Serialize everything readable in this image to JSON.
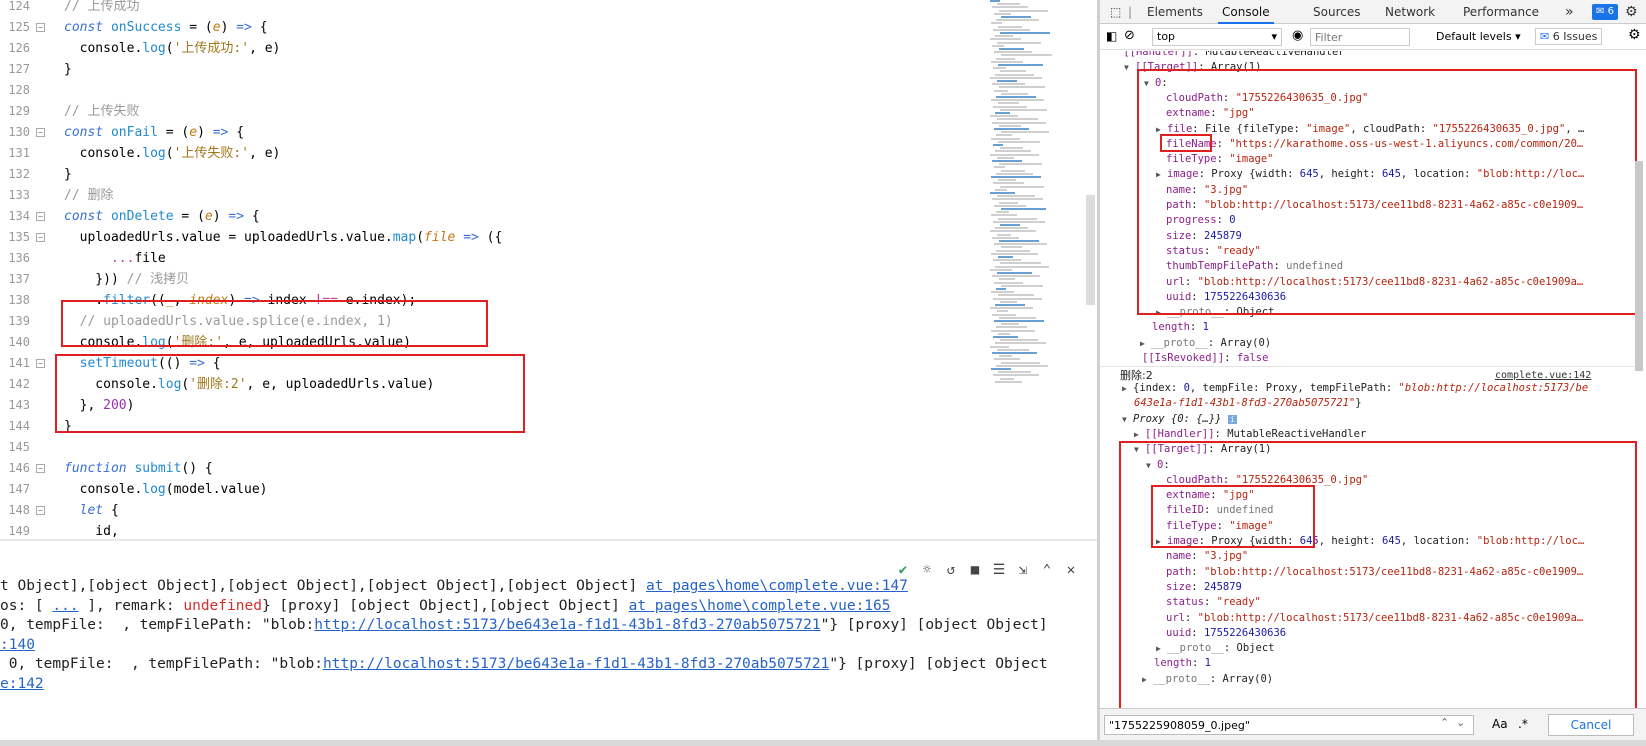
{
  "editor": {
    "lines": [
      {
        "n": "124",
        "fold": false,
        "html": "<span class=\"cm\">// 上传成功</span>"
      },
      {
        "n": "125",
        "fold": true,
        "html": "<span class=\"kw\">const</span> <span class=\"fn\">onSuccess</span> = (<span class=\"pa\">e</span>) <span class=\"kw\">=&gt;</span> {"
      },
      {
        "n": "126",
        "fold": false,
        "html": "  console.<span class=\"fn\">log</span>(<span class=\"st\">'上传成功:'</span>, e)"
      },
      {
        "n": "127",
        "fold": false,
        "html": "}"
      },
      {
        "n": "128",
        "fold": false,
        "html": ""
      },
      {
        "n": "129",
        "fold": false,
        "html": "<span class=\"cm\">// 上传失败</span>"
      },
      {
        "n": "130",
        "fold": true,
        "html": "<span class=\"kw\">const</span> <span class=\"fn\">onFail</span> = (<span class=\"pa\">e</span>) <span class=\"kw\">=&gt;</span> {"
      },
      {
        "n": "131",
        "fold": false,
        "html": "  console.<span class=\"fn\">log</span>(<span class=\"st\">'上传失败:'</span>, e)"
      },
      {
        "n": "132",
        "fold": false,
        "html": "}"
      },
      {
        "n": "133",
        "fold": false,
        "html": "<span class=\"cm\">// 删除</span>"
      },
      {
        "n": "134",
        "fold": true,
        "html": "<span class=\"kw\">const</span> <span class=\"fn\">onDelete</span> = (<span class=\"pa\">e</span>) <span class=\"kw\">=&gt;</span> {"
      },
      {
        "n": "135",
        "fold": true,
        "html": "  uploadedUrls.value = uploadedUrls.value.<span class=\"fn\">map</span>(<span class=\"pa\">file</span> <span class=\"kw\">=&gt;</span> ({"
      },
      {
        "n": "136",
        "fold": false,
        "html": "      <span class=\"sp\">...</span>file"
      },
      {
        "n": "137",
        "fold": false,
        "html": "    })) <span class=\"cm\">// 浅拷贝</span>"
      },
      {
        "n": "138",
        "fold": false,
        "html": "    .<span class=\"fn\">filter</span>((<span class=\"pa\">_</span>, <span class=\"pa\">index</span>) <span class=\"kw\">=&gt;</span> index <span class=\"sp\">!==</span> e.index);"
      },
      {
        "n": "139",
        "fold": false,
        "html": "  <span class=\"cm\">// uploadedUrls.value.splice(e.index, 1)</span>"
      },
      {
        "n": "140",
        "fold": false,
        "html": "  console.<span class=\"fn\">log</span>(<span class=\"st\">'删除:'</span>, e, uploadedUrls.value)"
      },
      {
        "n": "141",
        "fold": true,
        "html": "  <span class=\"fn\">setTimeout</span>(() <span class=\"kw\">=&gt;</span> {"
      },
      {
        "n": "142",
        "fold": false,
        "html": "    console.<span class=\"fn\">log</span>(<span class=\"st\">'删除:2'</span>, e, uploadedUrls.value)"
      },
      {
        "n": "143",
        "fold": false,
        "html": "  }, <span class=\"nu\">200</span>)"
      },
      {
        "n": "144",
        "fold": false,
        "html": "}"
      },
      {
        "n": "145",
        "fold": false,
        "html": ""
      },
      {
        "n": "146",
        "fold": true,
        "html": "<span class=\"kw\">function</span> <span class=\"fn\">submit</span>() {"
      },
      {
        "n": "147",
        "fold": false,
        "html": "  console.<span class=\"fn\">log</span>(model.value)"
      },
      {
        "n": "148",
        "fold": true,
        "html": "  <span class=\"kw\">let</span> {"
      },
      {
        "n": "149",
        "fold": false,
        "html": "    id,"
      }
    ]
  },
  "terminal": {
    "tools": [
      "✔",
      "☼",
      "↺",
      "■",
      "☰",
      "⇲",
      "⌃",
      "✕"
    ],
    "lines": [
      {
        "html": "t Object],[object Object],[object Object],[object Object],[object Object] <span class=\"lk\">at pages\\home\\complete.vue:147</span>"
      },
      {
        "html": "os: [ <span class=\"lk\">...</span> ], remark: <span class=\"cred\">undefined</span>} [proxy] [object Object],[object Object] <span class=\"lk\">at pages\\home\\complete.vue:165</span>"
      },
      {
        "html": "0, tempFile:  , tempFilePath: \"blob:<span class=\"lk\">http://localhost:5173/be643e1a-f1d1-43b1-8fd3-270ab5075721</span>\"} [proxy] [object Object]"
      },
      {
        "html": "<span class=\"lk\">:140</span>"
      },
      {
        "html": " 0, tempFile:  , tempFilePath: \"blob:<span class=\"lk\">http://localhost:5173/be643e1a-f1d1-43b1-8fd3-270ab5075721</span>\"} [proxy] [object Object"
      },
      {
        "html": "<span class=\"lk\">e:142</span>"
      }
    ]
  },
  "devtools": {
    "tabs": [
      "Elements",
      "Console",
      "Sources",
      "Network",
      "Performance"
    ],
    "more": "»",
    "badge": "6",
    "context": "top",
    "filter_placeholder": "Filter",
    "levels": "Default levels ▾",
    "issues": "6 Issues",
    "log_label": "删除:2",
    "log_link": "complete.vue:142",
    "console_lines": [
      {
        "x": 6,
        "html": "<span class=\"tri\"></span> <span class=\"k\">[[Handler]]</span>: MutableReactiveHandler"
      },
      {
        "x": 24,
        "html": "<span class=\"tri\">▼</span><span class=\"k\">[[Target]]</span>: Array(1)"
      },
      {
        "x": 44,
        "html": "<span class=\"tri\">▼</span><span class=\"k\">0</span>:"
      },
      {
        "x": 66,
        "html": "<span class=\"k\">cloudPath</span>: <span class=\"s\">\"1755226430635_0.jpg\"</span>"
      },
      {
        "x": 66,
        "html": "<span class=\"k\">extname</span>: <span class=\"s\">\"jpg\"</span>"
      },
      {
        "x": 56,
        "html": "<span class=\"tri\">▶</span><span class=\"k\">file</span>: File {fileType: <span class=\"s\">\"image\"</span>, cloudPath: <span class=\"s\">\"1755226430635_0.jpg\"</span>, …"
      },
      {
        "x": 66,
        "html": "<span class=\"k\">fileName</span>: <span class=\"s\">\"https://karathome.oss-us-west-1.aliyuncs.com/common/20…</span>"
      },
      {
        "x": 66,
        "html": "<span class=\"k\">fileType</span>: <span class=\"s\">\"image\"</span>"
      },
      {
        "x": 56,
        "html": "<span class=\"tri\">▶</span><span class=\"k\">image</span>: Proxy {width: <span class=\"n\">645</span>, height: <span class=\"n\">645</span>, location: <span class=\"s\">\"blob:http://loc…</span>"
      },
      {
        "x": 66,
        "html": "<span class=\"k\">name</span>: <span class=\"s\">\"3.jpg\"</span>"
      },
      {
        "x": 66,
        "html": "<span class=\"k\">path</span>: <span class=\"s\">\"blob:http://localhost:5173/cee11bd8-8231-4a62-a85c-c0e1909…</span>"
      },
      {
        "x": 66,
        "html": "<span class=\"k\">progress</span>: <span class=\"n\">0</span>"
      },
      {
        "x": 66,
        "html": "<span class=\"k\">size</span>: <span class=\"n\">245879</span>"
      },
      {
        "x": 66,
        "html": "<span class=\"k\">status</span>: <span class=\"s\">\"ready\"</span>"
      },
      {
        "x": 66,
        "html": "<span class=\"k\">thumbTempFilePath</span>: <span class=\"g\">undefined</span>"
      },
      {
        "x": 66,
        "html": "<span class=\"k\">url</span>: <span class=\"s\">\"blob:http://localhost:5173/cee11bd8-8231-4a62-a85c-c0e1909a…</span>"
      },
      {
        "x": 66,
        "html": "<span class=\"k\">uuid</span>: <span class=\"n\">1755226430636</span>"
      },
      {
        "x": 56,
        "html": "<span class=\"tri\">▶</span><span class=\"g\">__proto__</span>: Object"
      },
      {
        "x": 52,
        "html": "<span class=\"k\">length</span>: <span class=\"n\">1</span>"
      },
      {
        "x": 40,
        "html": "<span class=\"tri\">▶</span><span class=\"g\">__proto__</span>: Array(0)"
      },
      {
        "x": 42,
        "html": "<span class=\"k\">[[IsRevoked]]</span>: <span class=\"k\">false</span>"
      }
    ],
    "console_lines2": [
      {
        "x": 22,
        "html": "<span class=\"tri\">▶</span>{index: <span class=\"n\">0</span>, tempFile: Proxy, tempFilePath: <span class=\"s\"><i>\"blob:http://localhost:5173/be</i></span>"
      },
      {
        "x": 34,
        "html": "<span class=\"s\"><i>643e1a-f1d1-43b1-8fd3-270ab5075721\"</i></span>}"
      },
      {
        "x": 22,
        "html": "<span class=\"tri\">▼</span><i>Proxy {0: {…}}</i> <span style=\"color:#fff;background:#7aa7e0;font-size:8px;padding:0 2px\">i</span>"
      },
      {
        "x": 34,
        "html": "<span class=\"tri\">▶</span><span class=\"k\">[[Handler]]</span>: MutableReactiveHandler"
      },
      {
        "x": 34,
        "html": "<span class=\"tri\">▼</span><span class=\"k\">[[Target]]</span>: Array(1)"
      },
      {
        "x": 46,
        "html": "<span class=\"tri\">▼</span><span class=\"k\">0</span>:"
      },
      {
        "x": 66,
        "html": "<span class=\"k\">cloudPath</span>: <span class=\"s\">\"1755226430635_0.jpg\"</span>"
      },
      {
        "x": 66,
        "html": "<span class=\"k\">extname</span>: <span class=\"s\">\"jpg\"</span>"
      },
      {
        "x": 66,
        "html": "<span class=\"k\">fileID</span>: <span class=\"g\">undefined</span>"
      },
      {
        "x": 66,
        "html": "<span class=\"k\">fileType</span>: <span class=\"s\">\"image\"</span>"
      },
      {
        "x": 56,
        "html": "<span class=\"tri\">▶</span><span class=\"k\">image</span>: Proxy {width: <span class=\"n\">645</span>, height: <span class=\"n\">645</span>, location: <span class=\"s\">\"blob:http://loc…</span>"
      },
      {
        "x": 66,
        "html": "<span class=\"k\">name</span>: <span class=\"s\">\"3.jpg\"</span>"
      },
      {
        "x": 66,
        "html": "<span class=\"k\">path</span>: <span class=\"s\">\"blob:http://localhost:5173/cee11bd8-8231-4a62-a85c-c0e1909…</span>"
      },
      {
        "x": 66,
        "html": "<span class=\"k\">size</span>: <span class=\"n\">245879</span>"
      },
      {
        "x": 66,
        "html": "<span class=\"k\">status</span>: <span class=\"s\">\"ready\"</span>"
      },
      {
        "x": 66,
        "html": "<span class=\"k\">url</span>: <span class=\"s\">\"blob:http://localhost:5173/cee11bd8-8231-4a62-a85c-c0e1909a…</span>"
      },
      {
        "x": 66,
        "html": "<span class=\"k\">uuid</span>: <span class=\"n\">1755226430636</span>"
      },
      {
        "x": 56,
        "html": "<span class=\"tri\">▶</span><span class=\"g\">__proto__</span>: Object"
      },
      {
        "x": 54,
        "html": "<span class=\"k\">length</span>: <span class=\"n\">1</span>"
      },
      {
        "x": 42,
        "html": "<span class=\"tri\">▶</span><span class=\"g\">__proto__</span>: Array(0)"
      }
    ],
    "search_value": "\"1755225908059_0.jpeg\"",
    "search_aa": "Aa",
    "search_regex": ".*",
    "cancel": "Cancel"
  },
  "colors": {
    "accent": "#1a73e8",
    "highlight_box": "#e02020"
  }
}
